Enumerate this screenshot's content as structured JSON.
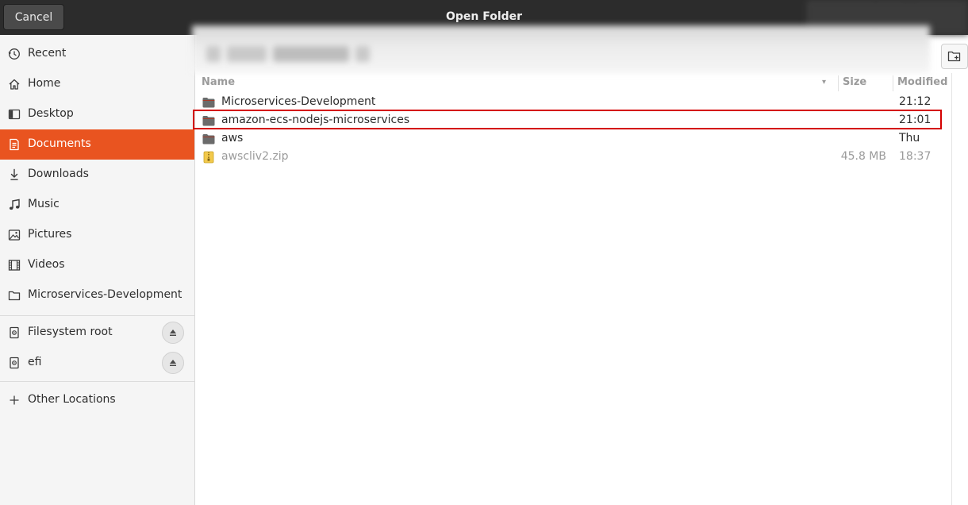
{
  "header": {
    "cancel_label": "Cancel",
    "title": "Open Folder"
  },
  "sidebar": {
    "items": [
      {
        "label": "Recent",
        "icon": "clock-icon"
      },
      {
        "label": "Home",
        "icon": "home-icon"
      },
      {
        "label": "Desktop",
        "icon": "desktop-icon"
      },
      {
        "label": "Documents",
        "icon": "document-icon",
        "active": true
      },
      {
        "label": "Downloads",
        "icon": "download-icon"
      },
      {
        "label": "Music",
        "icon": "music-note-icon"
      },
      {
        "label": "Pictures",
        "icon": "picture-icon"
      },
      {
        "label": "Videos",
        "icon": "film-icon"
      },
      {
        "label": "Microservices-Development",
        "icon": "folder-outline-icon"
      }
    ],
    "devices": [
      {
        "label": "Filesystem root",
        "icon": "drive-icon",
        "eject": true
      },
      {
        "label": "efi",
        "icon": "drive-icon",
        "eject": true
      }
    ],
    "other_locations": "Other Locations"
  },
  "file_list": {
    "columns": {
      "name": "Name",
      "size": "Size",
      "modified": "Modified"
    },
    "rows": [
      {
        "name": "Microservices-Development",
        "size": "",
        "modified": "21:12",
        "type": "folder"
      },
      {
        "name": "amazon-ecs-nodejs-microservices",
        "size": "",
        "modified": "21:01",
        "type": "folder",
        "highlighted": true
      },
      {
        "name": "aws",
        "size": "",
        "modified": "Thu",
        "type": "folder"
      },
      {
        "name": "awscliv2.zip",
        "size": "45.8 MB",
        "modified": "18:37",
        "type": "zip",
        "dimmed": true
      }
    ]
  },
  "colors": {
    "accent": "#e95420",
    "header_bg": "#2c2c2c",
    "highlight_border": "#d40000",
    "folder": "#6b6b6b"
  }
}
